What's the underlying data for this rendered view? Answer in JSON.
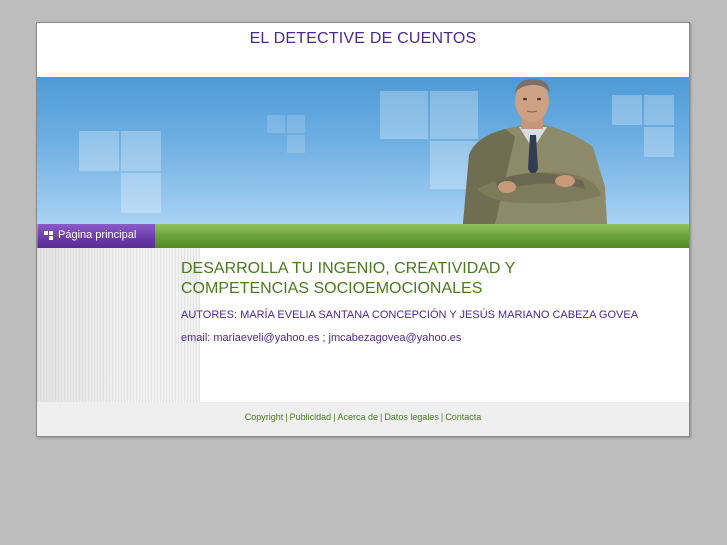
{
  "site": {
    "title": "EL DETECTIVE DE CUENTOS"
  },
  "nav": {
    "items": [
      {
        "label": "Página principal"
      }
    ]
  },
  "main": {
    "headline_line1": "DESARROLLA TU INGENIO, CREATIVIDAD Y",
    "headline_line2": "COMPETENCIAS SOCIOEMOCIONALES",
    "authors": "AUTORES: MARÍA EVELIA SANTANA CONCEPCIÓN Y JESÚS MARIANO CABEZA GOVEA",
    "email": "email: mariaeveli@yahoo.es ; jmcabezagovea@yahoo.es"
  },
  "footer": {
    "links": [
      "Copyright",
      "Publicidad",
      "Acerca de",
      "Datos legales",
      "Contacta"
    ],
    "separator": "|"
  },
  "colors": {
    "title": "#4b2a8f",
    "headline": "#4a7a1e",
    "nav_green": "#6aa33a",
    "nav_purple": "#6b3aa9",
    "background": "#bdbdbd"
  },
  "icons": {
    "nav": "grid-icon",
    "banner": "businessman-photo"
  }
}
